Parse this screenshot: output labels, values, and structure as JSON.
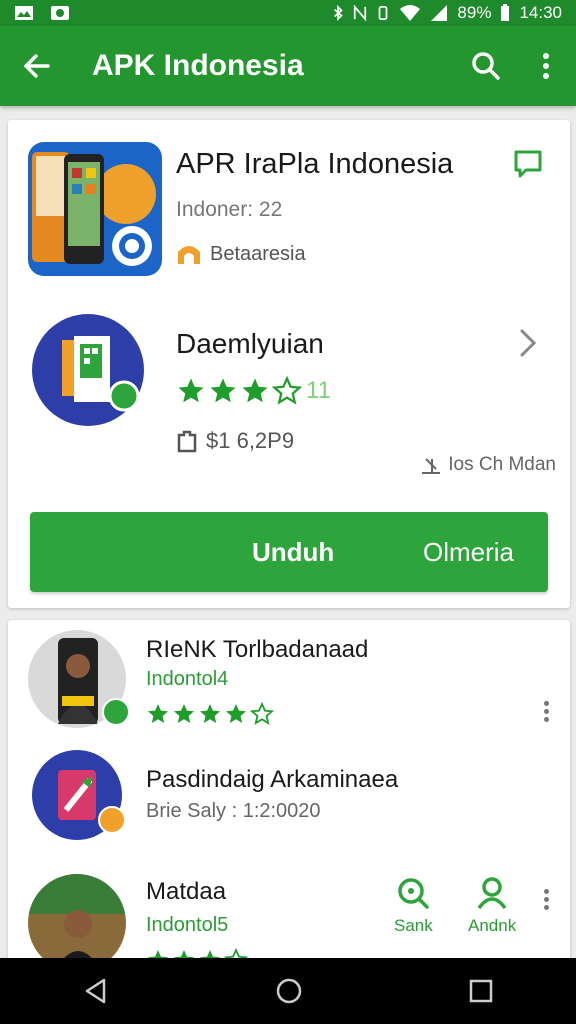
{
  "status_bar": {
    "battery": "89%",
    "time": "14:30"
  },
  "app_bar": {
    "title": "APK Indonesia"
  },
  "app_detail": {
    "name": "APR IraPla Indonesia",
    "subtitle": "Indoner: 22",
    "badge": "Betaaresia",
    "developer": "Daemlyuian",
    "rating_value": "11",
    "stars_filled": 3,
    "size": "$1 6,2P9",
    "meta_right": "Ios Ch Mdan",
    "install_label": "Unduh",
    "secondary_label": "Olmeria"
  },
  "list": [
    {
      "title": "RIeNK Torlbadanaad",
      "subtitle": "Indontol4",
      "stars_filled": 4
    },
    {
      "title": "Pasdindaig Arkaminaea",
      "subtitle": "Brie Saly : 1:2:0020"
    },
    {
      "title": "Matdaa",
      "subtitle": "Indontol5",
      "stars_filled": 3
    }
  ],
  "side_actions": {
    "search_label": "Sank",
    "profile_label": "Andnk"
  },
  "colors": {
    "primary": "#23962f",
    "accent": "#2ea53c",
    "star": "#1f9d2b"
  }
}
